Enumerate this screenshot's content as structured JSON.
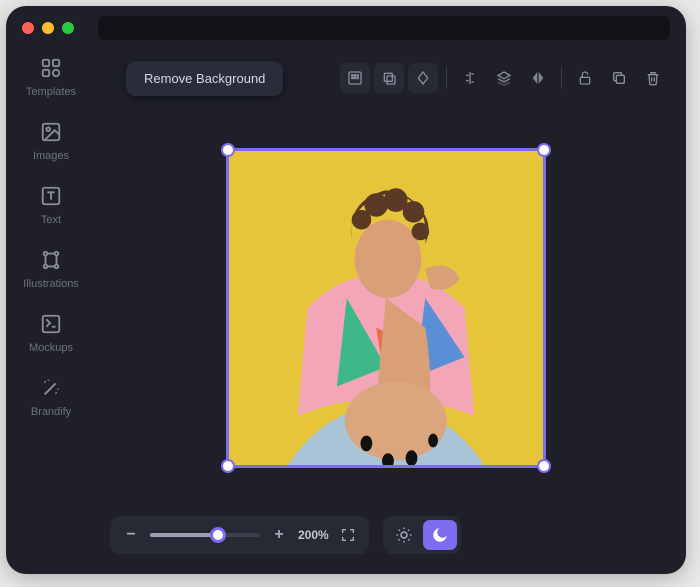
{
  "sidebar": {
    "items": [
      {
        "label": "Templates",
        "icon": "templates-icon"
      },
      {
        "label": "Images",
        "icon": "image-icon"
      },
      {
        "label": "Text",
        "icon": "text-icon"
      },
      {
        "label": "Illustrations",
        "icon": "illustrations-icon"
      },
      {
        "label": "Mockups",
        "icon": "mockups-icon"
      },
      {
        "label": "Brandify",
        "icon": "brandify-icon"
      }
    ]
  },
  "toolbar": {
    "remove_bg": "Remove Background"
  },
  "zoom": {
    "level": "200%",
    "slider_percent": 62
  },
  "theme": {
    "active": "dark"
  },
  "colors": {
    "accent": "#7b6cf0",
    "bg": "#1e1f29",
    "panel": "#272935"
  },
  "canvas": {
    "selected": true
  }
}
